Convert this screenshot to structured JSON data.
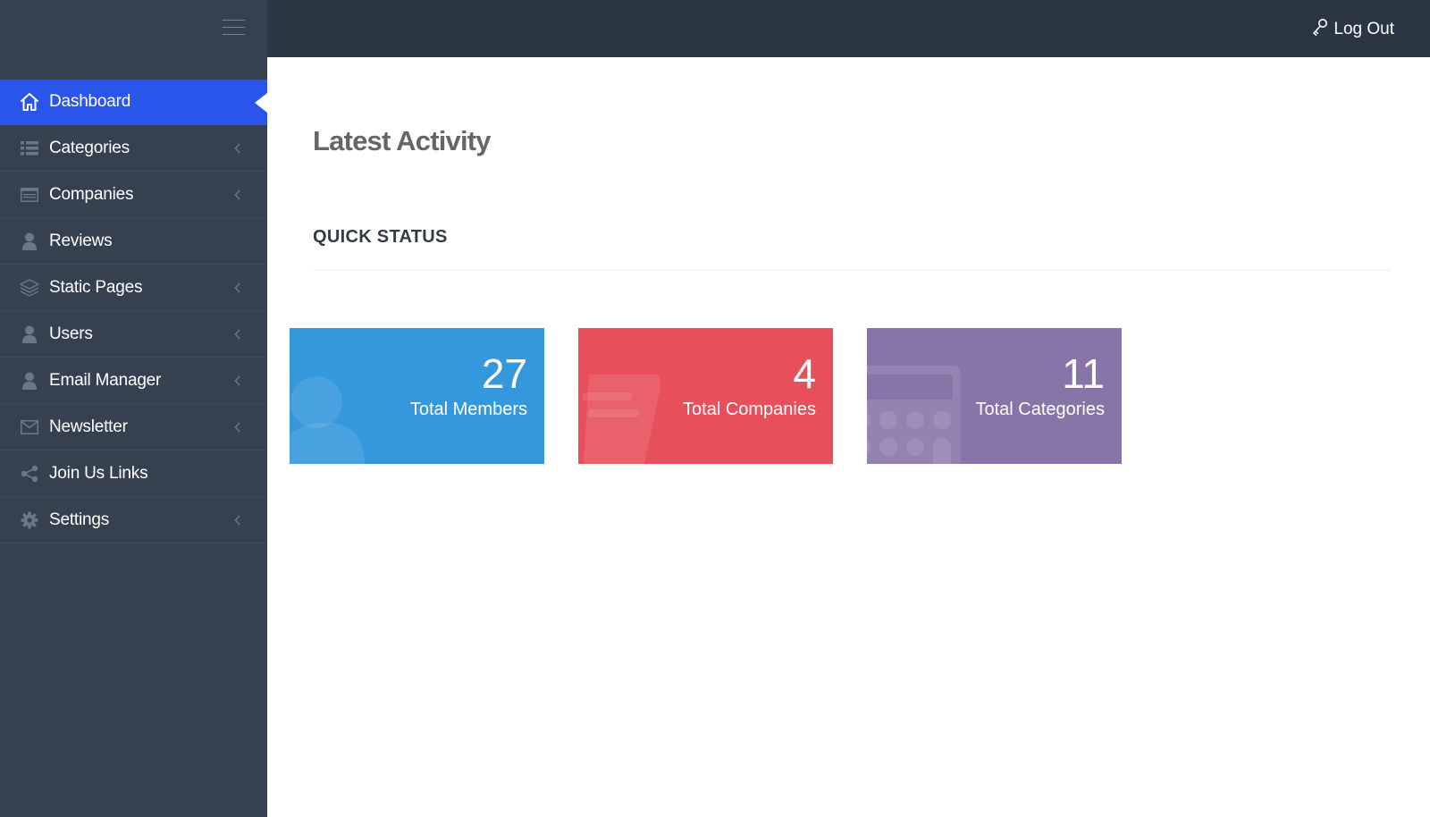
{
  "colors": {
    "sidebar_bg": "#364150",
    "topbar_bg": "#2b3643",
    "active_item": "#2a55ea",
    "members_tile": "#3598dc",
    "companies_tile": "#e7505a",
    "categories_tile": "#8775a7"
  },
  "header": {
    "menu_toggle_icon": "hamburger-icon",
    "logout_label": "Log Out",
    "logout_icon": "key-icon"
  },
  "sidebar": {
    "items": [
      {
        "label": "Dashboard",
        "icon": "home-icon",
        "active": true,
        "has_submenu": false
      },
      {
        "label": "Categories",
        "icon": "list-icon",
        "active": false,
        "has_submenu": true
      },
      {
        "label": "Companies",
        "icon": "card-icon",
        "active": false,
        "has_submenu": true
      },
      {
        "label": "Reviews",
        "icon": "user-icon",
        "active": false,
        "has_submenu": false
      },
      {
        "label": "Static Pages",
        "icon": "layers-icon",
        "active": false,
        "has_submenu": true
      },
      {
        "label": "Users",
        "icon": "user-icon",
        "active": false,
        "has_submenu": true
      },
      {
        "label": "Email Manager",
        "icon": "user-icon",
        "active": false,
        "has_submenu": true
      },
      {
        "label": "Newsletter",
        "icon": "envelope-icon",
        "active": false,
        "has_submenu": true
      },
      {
        "label": "Join Us Links",
        "icon": "share-icon",
        "active": false,
        "has_submenu": false
      },
      {
        "label": "Settings",
        "icon": "gear-icon",
        "active": false,
        "has_submenu": true
      }
    ]
  },
  "main": {
    "title": "Latest Activity",
    "section_title": "QUICK STATUS",
    "stats": [
      {
        "number": "27",
        "label": "Total Members",
        "icon": "user-icon"
      },
      {
        "number": "4",
        "label": "Total Companies",
        "icon": "document-icon"
      },
      {
        "number": "11",
        "label": "Total Categories",
        "icon": "calculator-icon"
      }
    ]
  }
}
